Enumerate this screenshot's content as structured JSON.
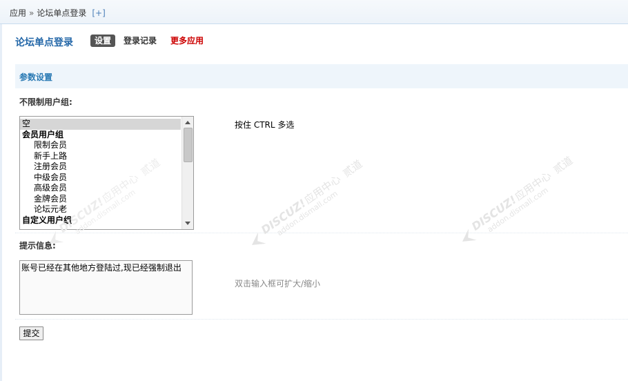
{
  "breadcrumb": {
    "root": "应用",
    "separator": "»",
    "current": "论坛单点登录",
    "add": "[+]"
  },
  "plugin": {
    "title": "论坛单点登录",
    "tabs": [
      {
        "label": "设置",
        "active": true
      },
      {
        "label": "登录记录",
        "active": false
      },
      {
        "label": "更多应用",
        "active": false,
        "color": "#cc0000"
      }
    ]
  },
  "section": {
    "title": "参数设置"
  },
  "groups": {
    "label": "不限制用户组:",
    "hint": "按住 CTRL 多选",
    "options": [
      {
        "label": "空",
        "kind": "option",
        "selected": true
      },
      {
        "label": "会员用户组",
        "kind": "group"
      },
      {
        "label": "限制会员",
        "kind": "sub"
      },
      {
        "label": "新手上路",
        "kind": "sub"
      },
      {
        "label": "注册会员",
        "kind": "sub"
      },
      {
        "label": "中级会员",
        "kind": "sub"
      },
      {
        "label": "高级会员",
        "kind": "sub"
      },
      {
        "label": "金牌会员",
        "kind": "sub"
      },
      {
        "label": "论坛元老",
        "kind": "sub"
      },
      {
        "label": "自定义用户组",
        "kind": "group"
      }
    ]
  },
  "tip": {
    "label": "提示信息:",
    "value": "账号已经在其他地方登陆过,现已经强制退出",
    "hint": "双击输入框可扩大/缩小"
  },
  "submit": {
    "label": "提交"
  },
  "watermark": {
    "brand": "DISCUZ!",
    "center": "应用中心",
    "vendor": "贰道",
    "domain": "addon.dismall.com",
    "color": "#dddddd"
  }
}
